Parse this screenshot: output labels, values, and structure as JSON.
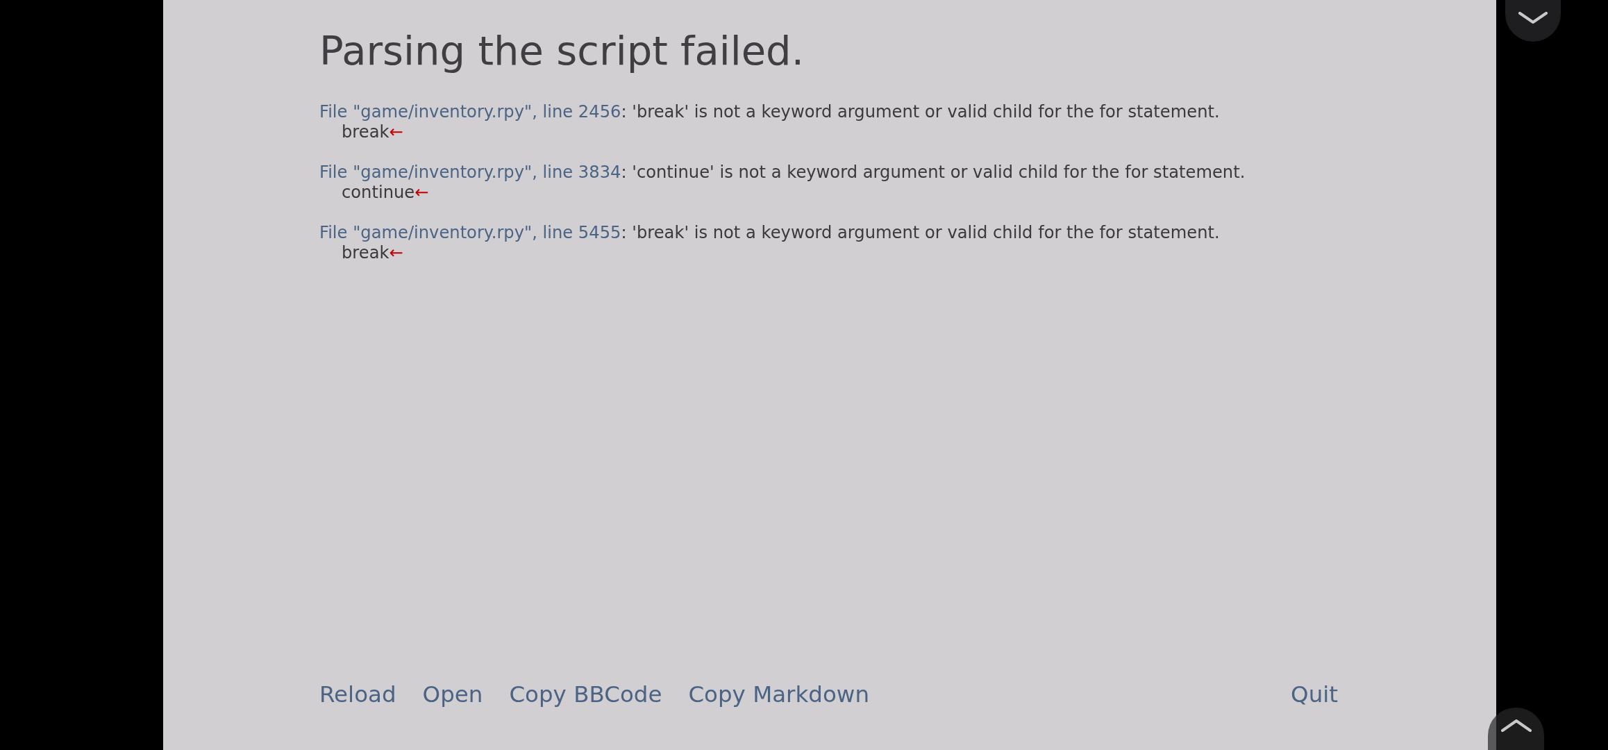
{
  "title": "Parsing the script failed.",
  "errors": [
    {
      "location": "File \"game/inventory.rpy\", line 2456",
      "message": ": 'break' is not a keyword argument or valid child for the for statement.",
      "code": "break",
      "pointer": "←"
    },
    {
      "location": "File \"game/inventory.rpy\", line 3834",
      "message": ": 'continue' is not a keyword argument or valid child for the for statement.",
      "code": "continue",
      "pointer": "←"
    },
    {
      "location": "File \"game/inventory.rpy\", line 5455",
      "message": ": 'break' is not a keyword argument or valid child for the for statement.",
      "code": "break",
      "pointer": "←"
    }
  ],
  "buttons": [
    {
      "label": "Reload"
    },
    {
      "label": "Open"
    },
    {
      "label": "Copy BBCode"
    },
    {
      "label": "Copy Markdown"
    }
  ],
  "quit_button": {
    "label": "Quit"
  }
}
